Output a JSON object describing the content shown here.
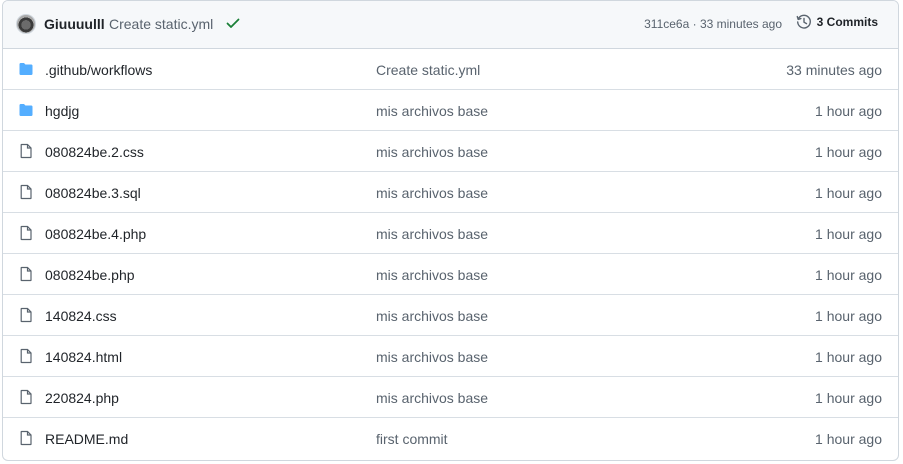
{
  "latest_commit": {
    "author": "Giuuuulll",
    "message": "Create static.yml",
    "status": "success",
    "hash_time": "311ce6a · 33 minutes ago",
    "commits_label": "3 Commits"
  },
  "colors": {
    "folder": "#54aeff",
    "check": "#1a7f37",
    "muted": "#59636e"
  },
  "files": [
    {
      "name": ".github/workflows",
      "type": "folder",
      "message": "Create static.yml",
      "time": "33 minutes ago"
    },
    {
      "name": "hgdjg",
      "type": "folder",
      "message": "mis archivos base",
      "time": "1 hour ago"
    },
    {
      "name": "080824be.2.css",
      "type": "file",
      "message": "mis archivos base",
      "time": "1 hour ago"
    },
    {
      "name": "080824be.3.sql",
      "type": "file",
      "message": "mis archivos base",
      "time": "1 hour ago"
    },
    {
      "name": "080824be.4.php",
      "type": "file",
      "message": "mis archivos base",
      "time": "1 hour ago"
    },
    {
      "name": "080824be.php",
      "type": "file",
      "message": "mis archivos base",
      "time": "1 hour ago"
    },
    {
      "name": "140824.css",
      "type": "file",
      "message": "mis archivos base",
      "time": "1 hour ago"
    },
    {
      "name": "140824.html",
      "type": "file",
      "message": "mis archivos base",
      "time": "1 hour ago"
    },
    {
      "name": "220824.php",
      "type": "file",
      "message": "mis archivos base",
      "time": "1 hour ago"
    },
    {
      "name": "README.md",
      "type": "file",
      "message": "first commit",
      "time": "1 hour ago"
    }
  ]
}
